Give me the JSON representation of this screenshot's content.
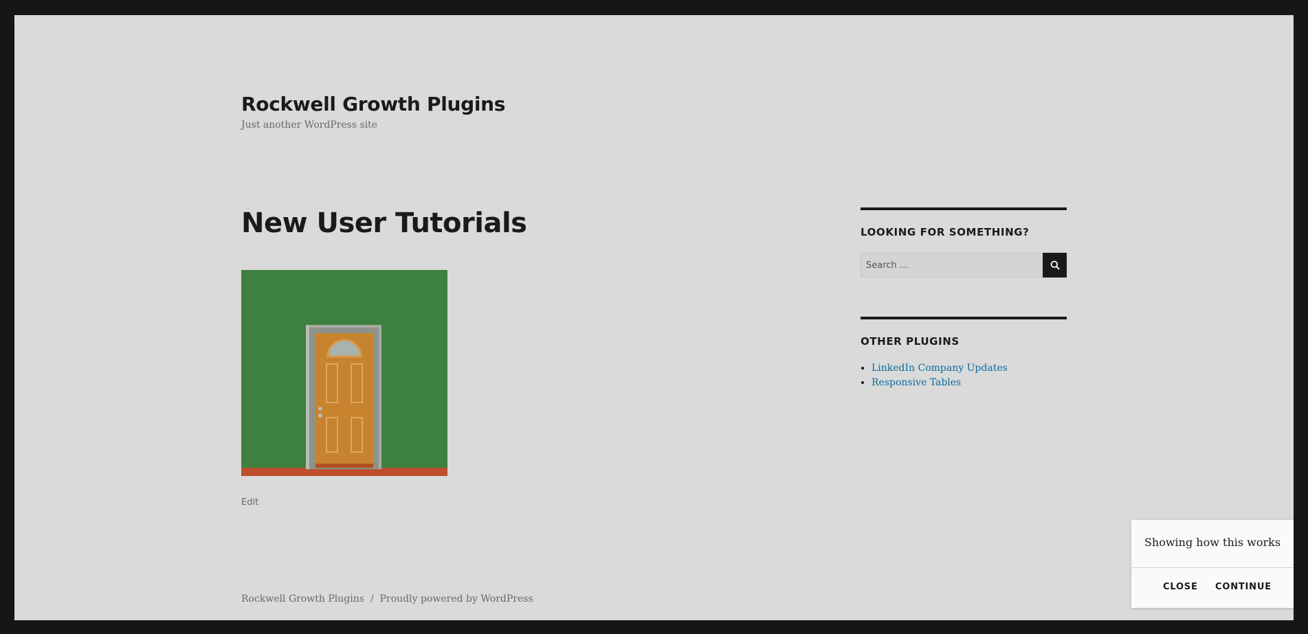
{
  "site": {
    "title": "Rockwell Growth Plugins",
    "tagline": "Just another WordPress site"
  },
  "entry": {
    "title": "New User Tutorials",
    "edit_label": "Edit",
    "image_icon": "door-illustration-icon"
  },
  "sidebar": {
    "search_widget": {
      "title": "LOOKING FOR SOMETHING?",
      "placeholder": "Search …",
      "button_icon": "search-icon"
    },
    "plugins_widget": {
      "title": "OTHER PLUGINS",
      "links": [
        "LinkedIn Company Updates",
        "Responsive Tables"
      ]
    }
  },
  "footer": {
    "site_name": "Rockwell Growth Plugins",
    "separator": "/",
    "powered_by": "Proudly powered by WordPress"
  },
  "tour_popup": {
    "message": "Showing how this works",
    "close_label": "CLOSE",
    "continue_label": "CONTINUE"
  },
  "colors": {
    "page_background": "#dadada",
    "frame_border": "#161616",
    "link": "#0a6aa1",
    "image_background": "#3e8040"
  }
}
